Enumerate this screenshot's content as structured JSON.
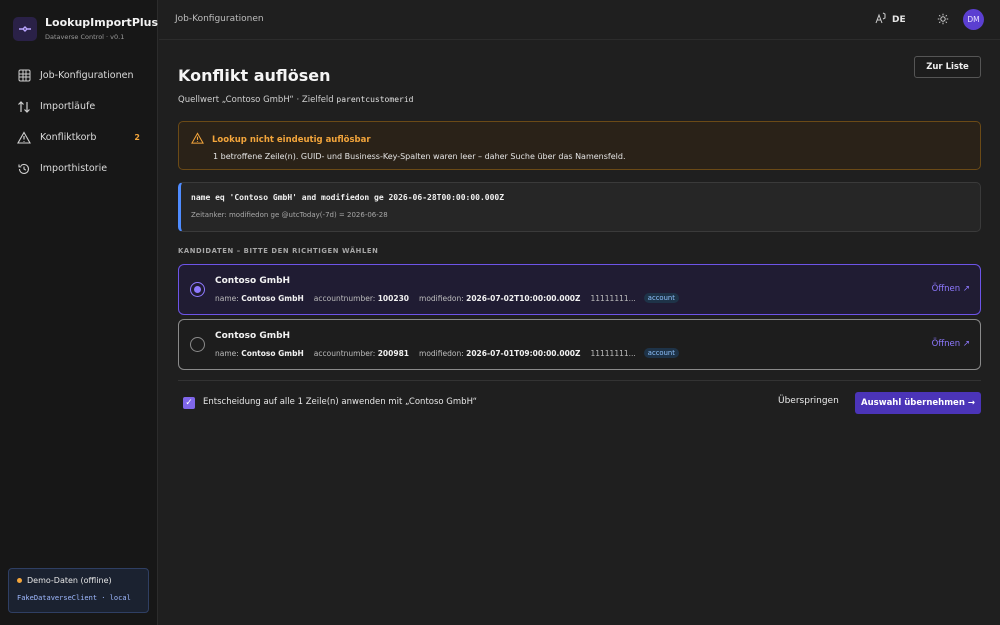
{
  "app": {
    "name": "LookupImportPlus",
    "subtitle": "Dataverse Control · v0.1"
  },
  "sidebar": {
    "items": [
      {
        "label": "Job-Konfigurationen",
        "icon": "grid-icon"
      },
      {
        "label": "Importläufe",
        "icon": "arrows-updown-icon"
      },
      {
        "label": "Konfliktkorb",
        "icon": "warning-icon",
        "badge": "2"
      },
      {
        "label": "Importhistorie",
        "icon": "history-icon"
      }
    ],
    "demo": {
      "title": "Demo-Daten (offline)",
      "subtitle": "FakeDataverseClient · local"
    }
  },
  "topbar": {
    "title": "Job-Konfigurationen",
    "language": "DE",
    "avatar": "DM"
  },
  "page": {
    "title": "Konflikt auflösen",
    "back_button": "Zur Liste",
    "subline_prefix": "Quellwert „Contoso GmbH“ · Zielfeld ",
    "target_field": "parentcustomerid"
  },
  "warning": {
    "title": "Lookup nicht eindeutig auflösbar",
    "message": "1 betroffene Zeile(n). GUID- und Business-Key-Spalten waren leer – daher Suche über das Namensfeld."
  },
  "query": {
    "code": "name eq 'Contoso GmbH' and modifiedon ge 2026-06-28T00:00:00.000Z",
    "note": "Zeitanker: modifiedon ge @utcToday(-7d) = 2026-06-28"
  },
  "candidates_label": "KANDIDATEN – BITTE DEN RICHTIGEN WÄHLEN",
  "candidates": [
    {
      "name": "Contoso GmbH",
      "name_label": "name:",
      "name_value": "Contoso GmbH",
      "accountnumber_label": "accountnumber:",
      "accountnumber": "100230",
      "modifiedon_label": "modifiedon:",
      "modifiedon": "2026-07-02T10:00:00.000Z",
      "id": "11111111...",
      "entity": "account",
      "open": "Öffnen ↗",
      "selected": true
    },
    {
      "name": "Contoso GmbH",
      "name_label": "name:",
      "name_value": "Contoso GmbH",
      "accountnumber_label": "accountnumber:",
      "accountnumber": "200981",
      "modifiedon_label": "modifiedon:",
      "modifiedon": "2026-07-01T09:00:00.000Z",
      "id": "11111111...",
      "entity": "account",
      "open": "Öffnen ↗",
      "selected": false
    }
  ],
  "footer": {
    "apply_all_label": "Entscheidung auf alle 1 Zeile(n) anwenden mit „Contoso GmbH“",
    "apply_all_checked": true,
    "skip": "Überspringen",
    "apply": "Auswahl übernehmen →"
  },
  "colors": {
    "accent": "#6d54e8",
    "warning": "#f3a53b",
    "info": "#4f8cff"
  }
}
